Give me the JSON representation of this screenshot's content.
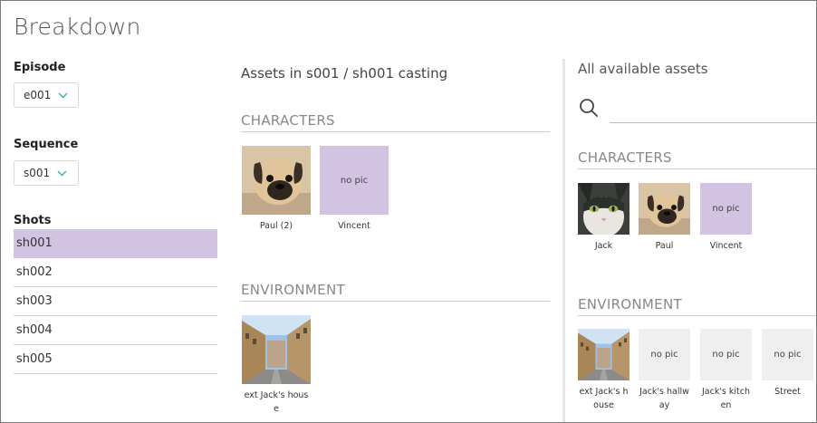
{
  "page": {
    "title": "Breakdown"
  },
  "filters": {
    "episode": {
      "label": "Episode",
      "value": "e001"
    },
    "sequence": {
      "label": "Sequence",
      "value": "s001"
    },
    "shots_label": "Shots",
    "shots": [
      "sh001",
      "sh002",
      "sh003",
      "sh004",
      "sh005"
    ]
  },
  "casting": {
    "title": "Assets in s001 / sh001 casting",
    "characters_label": "CHARACTERS",
    "characters": [
      {
        "name": "Paul (2)",
        "thumb": "pug-photo"
      },
      {
        "name": "Vincent",
        "no_pic": "no pic"
      }
    ],
    "environment_label": "ENVIRONMENT",
    "environment": [
      {
        "name": "ext Jack's house",
        "thumb": "street-photo"
      }
    ]
  },
  "available": {
    "title": "All available assets",
    "search_placeholder": "",
    "characters_label": "CHARACTERS",
    "characters": [
      {
        "name": "Jack",
        "thumb": "cat-photo"
      },
      {
        "name": "Paul",
        "thumb": "pug-photo"
      },
      {
        "name": "Vincent",
        "no_pic": "no pic"
      }
    ],
    "environment_label": "ENVIRONMENT",
    "environment": [
      {
        "name": "ext Jack's h ouse",
        "thumb": "street-photo"
      },
      {
        "name": "Jack's hallw ay",
        "no_pic": "no pic"
      },
      {
        "name": "Jack's kitch en",
        "no_pic": "no pic"
      },
      {
        "name": "Street",
        "no_pic": "no pic"
      }
    ]
  },
  "colors": {
    "selected": "#d2c3e3",
    "accent": "#2bb5ab",
    "no_pic_grey": "#efefef"
  }
}
